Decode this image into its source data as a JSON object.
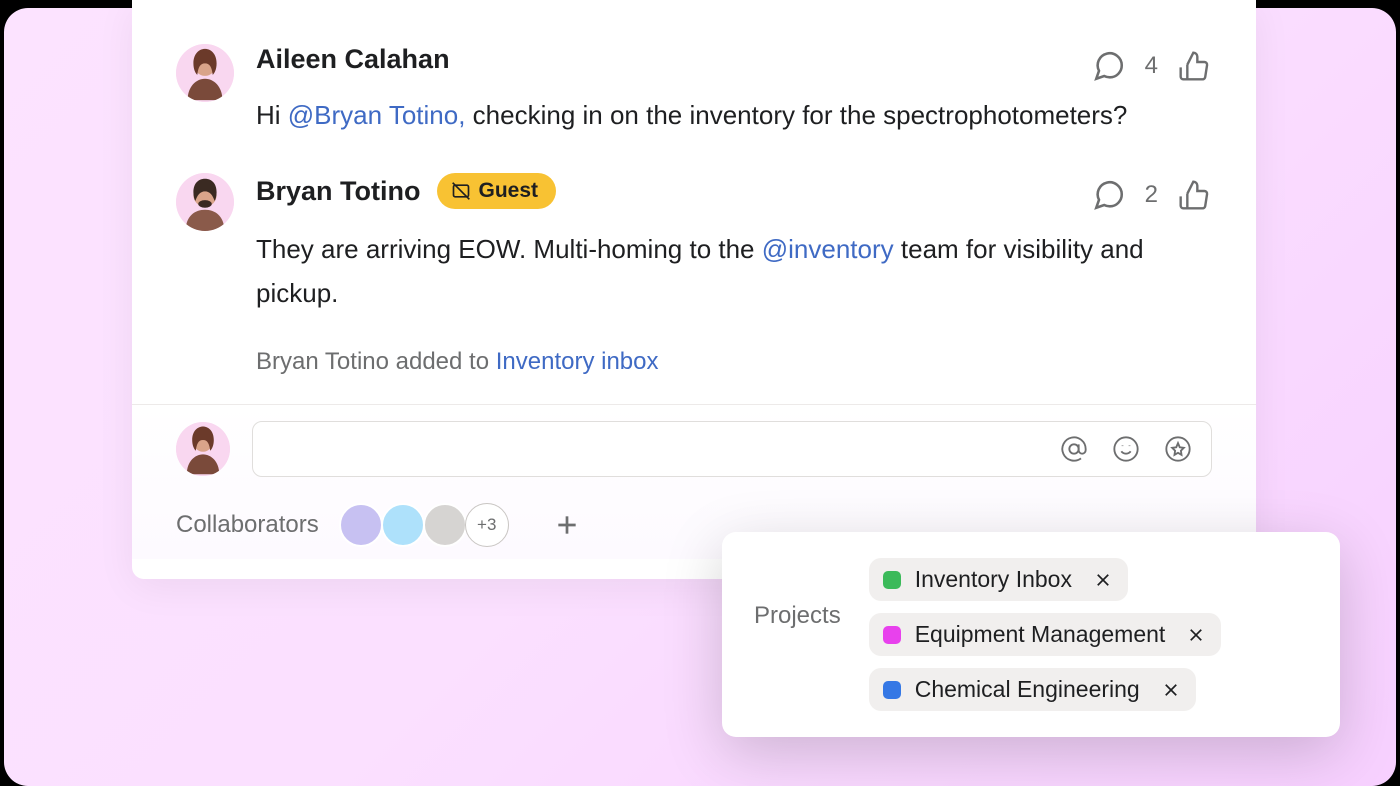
{
  "comments": [
    {
      "author": "Aileen Calahan",
      "guest": false,
      "text_pre": "Hi ",
      "mention": "@Bryan Totino,",
      "text_post": " checking in on the inventory for the spectrophotometers?",
      "likes": "4"
    },
    {
      "author": "Bryan Totino",
      "guest": true,
      "guest_label": "Guest",
      "text_pre": "They are arriving EOW. Multi-homing to the ",
      "mention": "@inventory",
      "text_post": " team for visibility and pickup.",
      "likes": "2"
    }
  ],
  "system_message": {
    "prefix": "Bryan Totino added to ",
    "link": "Inventory inbox"
  },
  "collaborators": {
    "label": "Collaborators",
    "more": "+3"
  },
  "projects": {
    "label": "Projects",
    "items": [
      {
        "name": "Inventory Inbox",
        "color": "green"
      },
      {
        "name": "Equipment Management",
        "color": "magenta"
      },
      {
        "name": "Chemical Engineering",
        "color": "blue"
      }
    ]
  }
}
